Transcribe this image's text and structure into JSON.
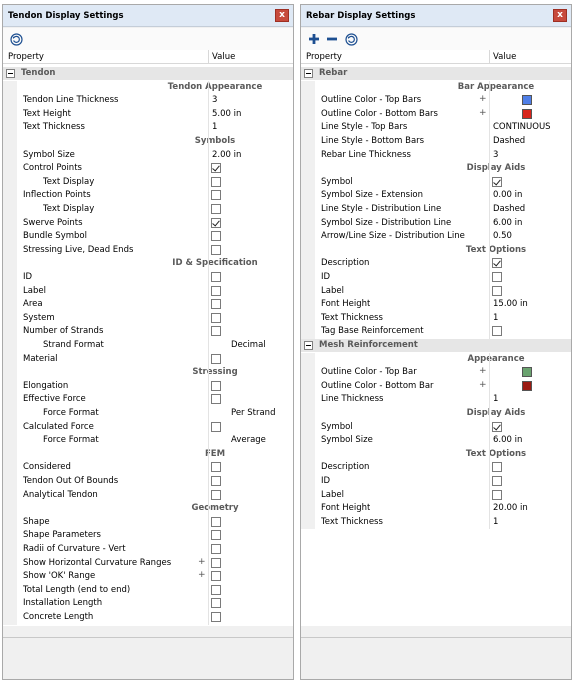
{
  "tendon": {
    "title": "Tendon Display Settings",
    "close_label": "x",
    "header": {
      "property": "Property",
      "value": "Value"
    },
    "rows": [
      {
        "kind": "group",
        "label": "Tendon"
      },
      {
        "kind": "sub",
        "label": "Tendon Appearance"
      },
      {
        "kind": "prop",
        "label": "Tendon Line Thickness",
        "value": "3"
      },
      {
        "kind": "prop",
        "label": "Text Height",
        "value": "5.00 in"
      },
      {
        "kind": "prop",
        "label": "Text Thickness",
        "value": "1"
      },
      {
        "kind": "sub",
        "label": "Symbols"
      },
      {
        "kind": "prop",
        "label": "Symbol Size",
        "value": "2.00 in"
      },
      {
        "kind": "check",
        "label": "Control Points",
        "checked": true
      },
      {
        "kind": "check",
        "label": "Text Display",
        "indent": true,
        "checked": false
      },
      {
        "kind": "check",
        "label": "Inflection Points",
        "checked": false
      },
      {
        "kind": "check",
        "label": "Text Display",
        "indent": true,
        "checked": false
      },
      {
        "kind": "check",
        "label": "Swerve Points",
        "checked": true
      },
      {
        "kind": "check",
        "label": "Bundle Symbol",
        "checked": false
      },
      {
        "kind": "check",
        "label": "Stressing Live, Dead Ends",
        "checked": false
      },
      {
        "kind": "sub",
        "label": "ID & Specification"
      },
      {
        "kind": "check",
        "label": "ID",
        "checked": false
      },
      {
        "kind": "check",
        "label": "Label",
        "checked": false
      },
      {
        "kind": "check",
        "label": "Area",
        "checked": false
      },
      {
        "kind": "check",
        "label": "System",
        "checked": false
      },
      {
        "kind": "check",
        "label": "Number of Strands",
        "checked": false
      },
      {
        "kind": "text",
        "label": "Strand Format",
        "indent": true,
        "value": "Decimal"
      },
      {
        "kind": "check",
        "label": "Material",
        "checked": false
      },
      {
        "kind": "sub",
        "label": "Stressing"
      },
      {
        "kind": "check",
        "label": "Elongation",
        "checked": false
      },
      {
        "kind": "check",
        "label": "Effective Force",
        "checked": false
      },
      {
        "kind": "text",
        "label": "Force Format",
        "indent": true,
        "value": "Per Strand"
      },
      {
        "kind": "check",
        "label": "Calculated Force",
        "checked": false
      },
      {
        "kind": "text",
        "label": "Force Format",
        "indent": true,
        "value": "Average"
      },
      {
        "kind": "sub",
        "label": "FEM"
      },
      {
        "kind": "check",
        "label": "Considered",
        "checked": false
      },
      {
        "kind": "check",
        "label": "Tendon Out Of Bounds",
        "checked": false
      },
      {
        "kind": "check",
        "label": "Analytical Tendon",
        "checked": false
      },
      {
        "kind": "sub",
        "label": "Geometry"
      },
      {
        "kind": "check",
        "label": "Shape",
        "checked": false
      },
      {
        "kind": "check",
        "label": "Shape Parameters",
        "checked": false
      },
      {
        "kind": "check",
        "label": "Radii of Curvature - Vert",
        "checked": false
      },
      {
        "kind": "check",
        "label": "Show Horizontal Curvature Ranges",
        "plus": "+",
        "checked": false
      },
      {
        "kind": "check",
        "label": "Show 'OK' Range",
        "plus": "+",
        "checked": false
      },
      {
        "kind": "check",
        "label": "Total Length (end to end)",
        "checked": false
      },
      {
        "kind": "check",
        "label": "Installation Length",
        "checked": false
      },
      {
        "kind": "check",
        "label": "Concrete Length",
        "checked": false
      }
    ]
  },
  "rebar": {
    "title": "Rebar Display Settings",
    "close_label": "x",
    "header": {
      "property": "Property",
      "value": "Value"
    },
    "rows": [
      {
        "kind": "group",
        "label": "Rebar"
      },
      {
        "kind": "sub",
        "label": "Bar Appearance"
      },
      {
        "kind": "color",
        "label": "Outline Color - Top Bars",
        "plus": "+",
        "color": "#4f7fe8"
      },
      {
        "kind": "color",
        "label": "Outline Color - Bottom Bars",
        "plus": "+",
        "color": "#d8261c"
      },
      {
        "kind": "prop",
        "label": "Line Style - Top Bars",
        "value": "CONTINUOUS"
      },
      {
        "kind": "prop",
        "label": "Line Style - Bottom Bars",
        "value": "Dashed"
      },
      {
        "kind": "prop",
        "label": "Rebar Line Thickness",
        "value": "3"
      },
      {
        "kind": "sub",
        "label": "Display Aids"
      },
      {
        "kind": "check",
        "label": "Symbol",
        "checked": true
      },
      {
        "kind": "prop",
        "label": "Symbol Size - Extension",
        "value": "0.00 in"
      },
      {
        "kind": "prop",
        "label": "Line Style - Distribution Line",
        "value": "Dashed"
      },
      {
        "kind": "prop",
        "label": "Symbol Size - Distribution Line",
        "value": "6.00 in"
      },
      {
        "kind": "prop",
        "label": "Arrow/Line Size - Distribution Line",
        "value": "0.50"
      },
      {
        "kind": "sub",
        "label": "Text Options"
      },
      {
        "kind": "check",
        "label": "Description",
        "checked": true
      },
      {
        "kind": "check",
        "label": "ID",
        "checked": false
      },
      {
        "kind": "check",
        "label": "Label",
        "checked": false
      },
      {
        "kind": "prop",
        "label": "Font Height",
        "value": "15.00 in"
      },
      {
        "kind": "prop",
        "label": "Text Thickness",
        "value": "1"
      },
      {
        "kind": "check",
        "label": "Tag Base Reinforcement",
        "checked": false
      },
      {
        "kind": "group",
        "label": "Mesh Reinforcement"
      },
      {
        "kind": "sub",
        "label": "Appearance"
      },
      {
        "kind": "color",
        "label": "Outline Color - Top Bar",
        "plus": "+",
        "color": "#6aa36f"
      },
      {
        "kind": "color",
        "label": "Outline Color - Bottom Bar",
        "plus": "+",
        "color": "#9b1b12"
      },
      {
        "kind": "prop",
        "label": "Line Thickness",
        "value": "1"
      },
      {
        "kind": "sub",
        "label": "Display Aids"
      },
      {
        "kind": "check",
        "label": "Symbol",
        "checked": true
      },
      {
        "kind": "prop",
        "label": "Symbol Size",
        "value": "6.00 in"
      },
      {
        "kind": "sub",
        "label": "Text Options"
      },
      {
        "kind": "check",
        "label": "Description",
        "checked": false
      },
      {
        "kind": "check",
        "label": "ID",
        "checked": false
      },
      {
        "kind": "check",
        "label": "Label",
        "checked": false
      },
      {
        "kind": "prop",
        "label": "Font Height",
        "value": "20.00 in"
      },
      {
        "kind": "prop",
        "label": "Text Thickness",
        "value": "1"
      }
    ]
  },
  "icons": {
    "reset": "reset-icon",
    "add": "plus-icon",
    "remove": "minus-icon",
    "close": "close-icon"
  },
  "colors": {
    "titlebar": "#dfe9f5",
    "close_button": "#c74a3c",
    "toolbar_icon": "#1d4f91"
  }
}
